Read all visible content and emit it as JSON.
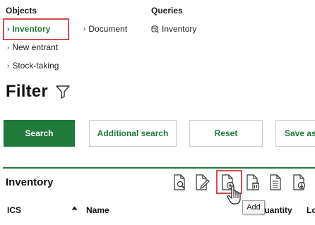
{
  "sections": {
    "objects_title": "Objects",
    "queries_title": "Queries",
    "objects_items": [
      "Inventory",
      "New entrant",
      "Stock-taking",
      "Document"
    ],
    "query_items": [
      "Inventory"
    ]
  },
  "filter": {
    "title": "Filter"
  },
  "buttons": {
    "search": "Search",
    "additional_search": "Additional search",
    "reset": "Reset",
    "save_as": "Save as"
  },
  "list": {
    "title": "Inventory",
    "columns": [
      "ICS",
      "Name",
      "Quantity",
      "Lo"
    ]
  },
  "tooltip": "Add",
  "colors": {
    "accent": "#1f7a3c",
    "highlight": "#e0464b"
  }
}
